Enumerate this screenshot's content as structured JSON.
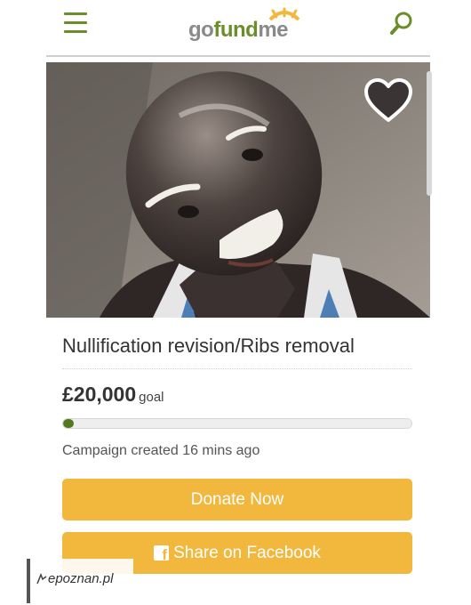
{
  "header": {
    "logo": {
      "part1": "go",
      "part2": "fund",
      "part3": "me"
    }
  },
  "campaign": {
    "title": "Nullification revision/Ribs removal",
    "goal_amount": "£20,000",
    "goal_label": "goal",
    "progress_fraction": 0.03,
    "created_text": "Campaign created 16 mins ago"
  },
  "actions": {
    "donate_label": "Donate Now",
    "share_label": "Share on Facebook"
  },
  "watermark": {
    "text": "epoznan.pl"
  },
  "colors": {
    "brand_green": "#6a8f2a",
    "button_orange": "#f2b83e",
    "progress_green": "#4f7a1f"
  },
  "icons": [
    "menu-icon",
    "search-icon",
    "heart-icon",
    "facebook-icon"
  ]
}
